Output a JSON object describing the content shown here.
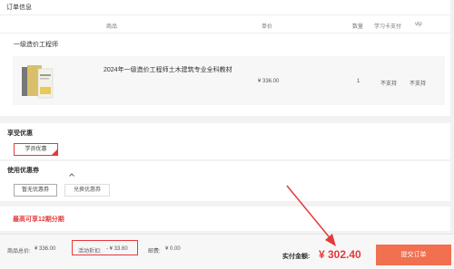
{
  "order": {
    "section_title": "订单信息",
    "columns": [
      "商品",
      "单价",
      "数量",
      "学习卡支付",
      "vip"
    ],
    "group_title": "一级造价工程师",
    "item": {
      "name": "2024年一级造价工程师土木建筑专业全科教材",
      "price": "¥ 336.00",
      "qty": "1",
      "card_pay": "不支持",
      "vip": "不支持"
    }
  },
  "benefits": {
    "title": "享受优惠",
    "student_button": "学员优惠"
  },
  "coupons": {
    "title": "使用优惠券",
    "tab_none": "暂无优惠券",
    "tab_redeem": "兑换优惠券"
  },
  "installment": {
    "text": "最高可享12期分期"
  },
  "footer": {
    "goods_total_label": "商品总价:",
    "goods_total_value": "¥ 336.00",
    "discount_label": "活动折扣:",
    "discount_value": "- ¥ 33.60",
    "shipping_label": "邮费:",
    "shipping_value": "¥ 0.00",
    "pay_label": "实付金额:",
    "pay_value": "¥ 302.40",
    "submit": "提交订单"
  },
  "colors": {
    "accent": "#e4393c",
    "submit_bg": "#f1704f",
    "divider": "#eeeeee"
  }
}
